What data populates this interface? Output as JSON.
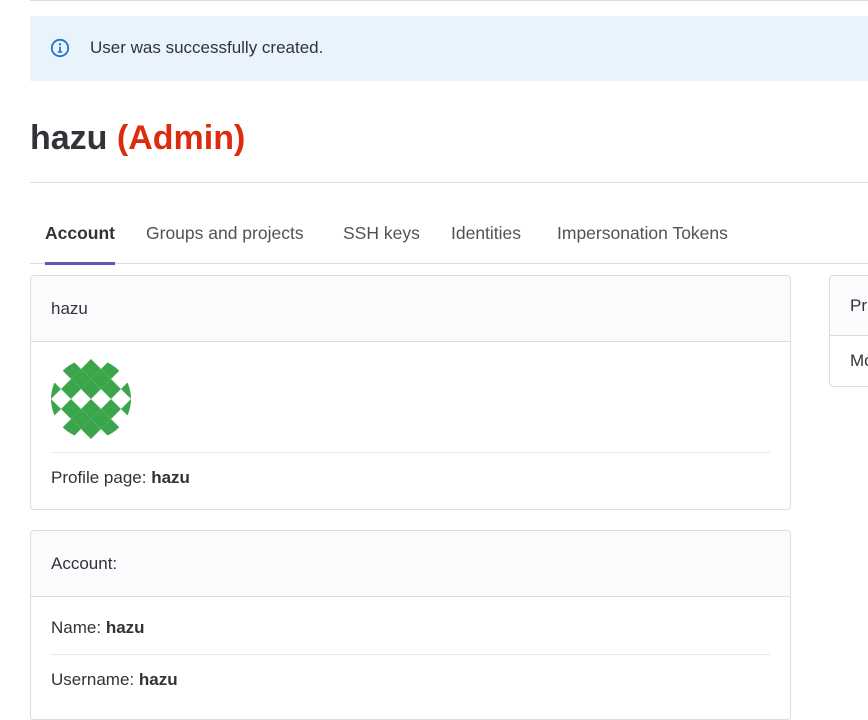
{
  "alert": {
    "icon": "info-icon",
    "message": "User was successfully created.",
    "color": "#1f75cb"
  },
  "user": {
    "name": "hazu",
    "admin_badge": "(Admin)"
  },
  "tabs": [
    {
      "label": "Account",
      "active": true
    },
    {
      "label": "Groups and projects",
      "active": false
    },
    {
      "label": "SSH keys",
      "active": false
    },
    {
      "label": "Identities",
      "active": false
    },
    {
      "label": "Impersonation Tokens",
      "active": false
    }
  ],
  "profile_card": {
    "header": "hazu",
    "avatar_color": "#3aa54b",
    "profile_label": "Profile page:",
    "profile_value": "hazu"
  },
  "account_card": {
    "header": "Account:",
    "name_label": "Name:",
    "name_value": "hazu",
    "username_label": "Username:",
    "username_value": "hazu"
  },
  "side_card": {
    "header": "Pr",
    "row": "Mo"
  },
  "colors": {
    "admin": "#dd2b0e",
    "tab_indicator": "#6b4fbb",
    "alert_bg": "#e9f3fc"
  }
}
